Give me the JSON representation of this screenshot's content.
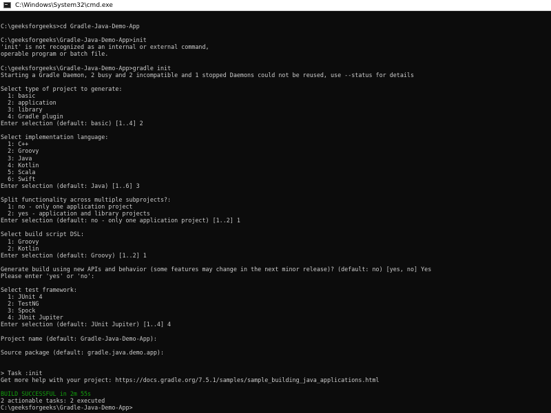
{
  "window": {
    "title": "C:\\Windows\\System32\\cmd.exe",
    "icon": "command-prompt-icon"
  },
  "colors": {
    "background": "#0c0c0c",
    "text": "#cccccc",
    "success": "#13a10e"
  },
  "console": {
    "lines": [
      {
        "text": ""
      },
      {
        "text": "C:\\geeksforgeeks>cd Gradle-Java-Demo-App"
      },
      {
        "text": ""
      },
      {
        "text": "C:\\geeksforgeeks\\Gradle-Java-Demo-App>init"
      },
      {
        "text": "'init' is not recognized as an internal or external command,"
      },
      {
        "text": "operable program or batch file."
      },
      {
        "text": ""
      },
      {
        "text": "C:\\geeksforgeeks\\Gradle-Java-Demo-App>gradle init"
      },
      {
        "text": "Starting a Gradle Daemon, 2 busy and 2 incompatible and 1 stopped Daemons could not be reused, use --status for details"
      },
      {
        "text": ""
      },
      {
        "text": "Select type of project to generate:"
      },
      {
        "text": "  1: basic"
      },
      {
        "text": "  2: application"
      },
      {
        "text": "  3: library"
      },
      {
        "text": "  4: Gradle plugin"
      },
      {
        "text": "Enter selection (default: basic) [1..4] 2"
      },
      {
        "text": ""
      },
      {
        "text": "Select implementation language:"
      },
      {
        "text": "  1: C++"
      },
      {
        "text": "  2: Groovy"
      },
      {
        "text": "  3: Java"
      },
      {
        "text": "  4: Kotlin"
      },
      {
        "text": "  5: Scala"
      },
      {
        "text": "  6: Swift"
      },
      {
        "text": "Enter selection (default: Java) [1..6] 3"
      },
      {
        "text": ""
      },
      {
        "text": "Split functionality across multiple subprojects?:"
      },
      {
        "text": "  1: no - only one application project"
      },
      {
        "text": "  2: yes - application and library projects"
      },
      {
        "text": "Enter selection (default: no - only one application project) [1..2] 1"
      },
      {
        "text": ""
      },
      {
        "text": "Select build script DSL:"
      },
      {
        "text": "  1: Groovy"
      },
      {
        "text": "  2: Kotlin"
      },
      {
        "text": "Enter selection (default: Groovy) [1..2] 1"
      },
      {
        "text": ""
      },
      {
        "text": "Generate build using new APIs and behavior (some features may change in the next minor release)? (default: no) [yes, no] Yes"
      },
      {
        "text": "Please enter 'yes' or 'no':"
      },
      {
        "text": ""
      },
      {
        "text": "Select test framework:"
      },
      {
        "text": "  1: JUnit 4"
      },
      {
        "text": "  2: TestNG"
      },
      {
        "text": "  3: Spock"
      },
      {
        "text": "  4: JUnit Jupiter"
      },
      {
        "text": "Enter selection (default: JUnit Jupiter) [1..4] 4"
      },
      {
        "text": ""
      },
      {
        "text": "Project name (default: Gradle-Java-Demo-App):"
      },
      {
        "text": ""
      },
      {
        "text": "Source package (default: gradle.java.demo.app):"
      },
      {
        "text": ""
      },
      {
        "text": ""
      },
      {
        "text": "> Task :init"
      },
      {
        "text": "Get more help with your project: https://docs.gradle.org/7.5.1/samples/sample_building_java_applications.html"
      },
      {
        "text": ""
      },
      {
        "text": "BUILD SUCCESSFUL in 2m 55s",
        "style": "success"
      },
      {
        "text": "2 actionable tasks: 2 executed"
      },
      {
        "text": "C:\\geeksforgeeks\\Gradle-Java-Demo-App>"
      }
    ]
  }
}
